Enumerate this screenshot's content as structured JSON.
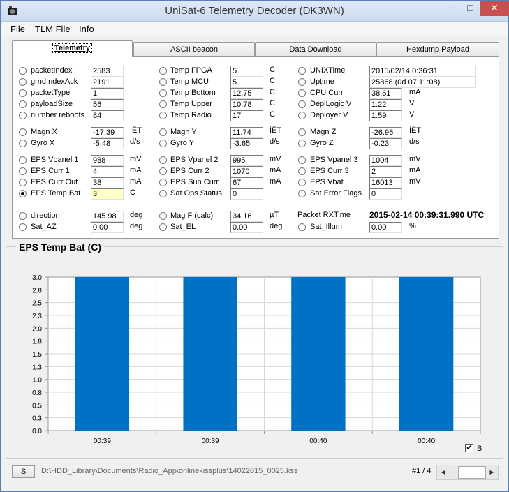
{
  "window": {
    "title": "UniSat-6 Telemetry Decoder (DK3WN)",
    "minimize": "−",
    "maximize": "□",
    "close": "✕"
  },
  "menu": [
    "File",
    "TLM File",
    "Info"
  ],
  "tabs": [
    "Telemetry",
    "ASCII beacon",
    "Data Download",
    "Hexdump Payload"
  ],
  "active_tab": "Telemetry",
  "col1": [
    {
      "label": "packetIndex",
      "value": "2583",
      "unit": ""
    },
    {
      "label": "grndIndexAck",
      "value": "2191",
      "unit": ""
    },
    {
      "label": "packetType",
      "value": "1",
      "unit": ""
    },
    {
      "label": "payloadSize",
      "value": "56",
      "unit": ""
    },
    {
      "label": "number reboots",
      "value": "84",
      "unit": ""
    }
  ],
  "col2": [
    {
      "label": "Temp FPGA",
      "value": "5",
      "unit": "C"
    },
    {
      "label": "Temp MCU",
      "value": "5",
      "unit": "C"
    },
    {
      "label": "Temp Bottom",
      "value": "12.75",
      "unit": "C"
    },
    {
      "label": "Temp Upper",
      "value": "10.78",
      "unit": "C"
    },
    {
      "label": "Temp Radio",
      "value": "17",
      "unit": "C"
    }
  ],
  "col3": [
    {
      "label": "UNIXTime",
      "value": "2015/02/14 0:36:31",
      "unit": ""
    },
    {
      "label": "Uptime",
      "value": "25868  (0d 07:11:08)",
      "unit": ""
    },
    {
      "label": "CPU Curr",
      "value": "38.61",
      "unit": "mA"
    },
    {
      "label": "DeplLogic V",
      "value": "1.22",
      "unit": "V"
    },
    {
      "label": "Deployer V",
      "value": "1.59",
      "unit": "V"
    }
  ],
  "mag_gyro": [
    {
      "label": "Magn X",
      "value": "-17.39",
      "unit": "ÌÊT"
    },
    {
      "label": "Gyro X",
      "value": "-5.48",
      "unit": "d/s"
    },
    {
      "label": "Magn Y",
      "value": "11.74",
      "unit": "ÌÊT"
    },
    {
      "label": "Gyro Y",
      "value": "-3.65",
      "unit": "d/s"
    },
    {
      "label": "Magn Z",
      "value": "-26.96",
      "unit": "ÌÊT"
    },
    {
      "label": "Gyro Z",
      "value": "-0.23",
      "unit": "d/s"
    }
  ],
  "eps": [
    {
      "label": "EPS Vpanel 1",
      "value": "988",
      "unit": "mV"
    },
    {
      "label": "EPS Curr 1",
      "value": "4",
      "unit": "mA"
    },
    {
      "label": "EPS Curr Out",
      "value": "38",
      "unit": "mA"
    },
    {
      "label": "EPS Temp Bat",
      "value": "3",
      "unit": "C"
    },
    {
      "label": "EPS Vpanel 2",
      "value": "995",
      "unit": "mV"
    },
    {
      "label": "EPS Curr 2",
      "value": "1070",
      "unit": "mA"
    },
    {
      "label": "EPS Sun Curr",
      "value": "67",
      "unit": "mA"
    },
    {
      "label": "Sat Ops Status",
      "value": "0",
      "unit": ""
    },
    {
      "label": "EPS Vpanel 3",
      "value": "1004",
      "unit": "mV"
    },
    {
      "label": "EPS Curr 3",
      "value": "2",
      "unit": "mA"
    },
    {
      "label": "EPS Vbat",
      "value": "16013",
      "unit": "mV"
    },
    {
      "label": "Sat Error Flags",
      "value": "0",
      "unit": ""
    }
  ],
  "bottom": [
    {
      "label": "direction",
      "value": "145.98",
      "unit": "deg"
    },
    {
      "label": "Sat_AZ",
      "value": "0.00",
      "unit": "deg"
    },
    {
      "label": "Mag F (calc)",
      "value": "34.16",
      "unit": "µT"
    },
    {
      "label": "Sat_EL",
      "value": "0.00",
      "unit": "deg"
    },
    {
      "label": "Sat_Illum",
      "value": "0.00",
      "unit": "%"
    }
  ],
  "packet_rx": {
    "label": "Packet RXTime",
    "value": "2015-02-14 00:39:31.990 UTC"
  },
  "chart_data": {
    "type": "bar",
    "title": "EPS Temp Bat (C)",
    "categories": [
      "00:39",
      "00:39",
      "00:40",
      "00:40"
    ],
    "values": [
      3.0,
      3.0,
      3.0,
      3.0
    ],
    "ylim": [
      0.0,
      3.0
    ],
    "yticks": [
      "0.0",
      "0.3",
      "0.5",
      "0.8",
      "1.0",
      "1.3",
      "1.5",
      "1.8",
      "2.0",
      "2.3",
      "2.5",
      "2.8",
      "3.0"
    ],
    "bar_color": "#0072c6",
    "grid": true
  },
  "legend": {
    "label": "B",
    "checked": "✔"
  },
  "status": {
    "s_button": "S",
    "path": "D:\\HDD_Library\\Documents\\Radio_App\\onlinekissplus\\14022015_0025.kss",
    "page": "#1 / 4",
    "left": "◀",
    "right": "▶"
  }
}
